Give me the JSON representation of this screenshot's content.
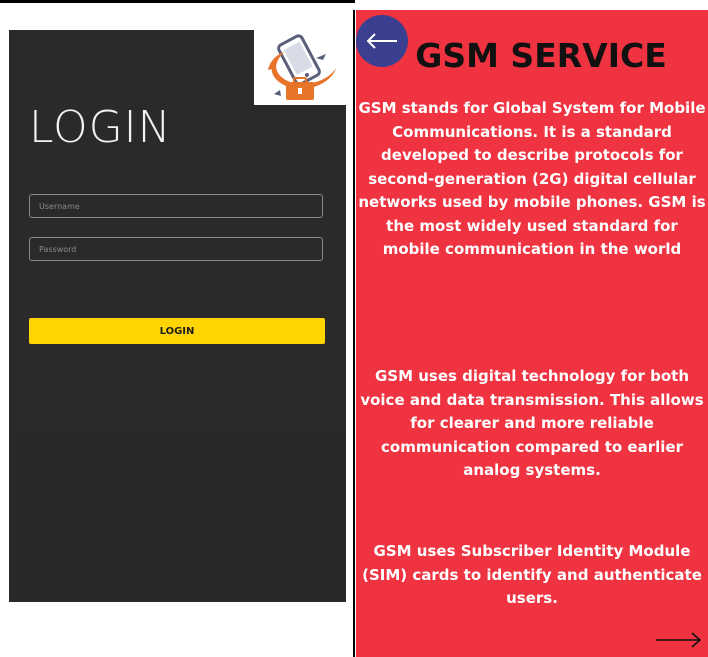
{
  "login": {
    "heading": "LOGIN",
    "username_placeholder": "Username",
    "password_placeholder": "Password",
    "button_label": "LOGIN",
    "accent_color": "#ffd400",
    "background_color": "#2a2a2a",
    "logo_icon": "mobile-repair-logo-icon"
  },
  "info": {
    "title": "GSM SERVICE",
    "paragraphs": [
      "GSM stands for Global System for Mobile Communications. It is a standard developed to describe protocols for second-generation (2G) digital cellular networks used by mobile phones. GSM is the most widely used standard for mobile communication in the world",
      "GSM uses digital technology for both voice and data transmission. This allows for clearer and more reliable communication compared to earlier analog systems.",
      "GSM uses Subscriber Identity Module (SIM) cards to identify and authenticate users."
    ],
    "background_color": "#ef3340",
    "back_button_color": "#3a3f8f",
    "back_icon": "arrow-left-icon",
    "next_icon": "arrow-right-icon"
  }
}
